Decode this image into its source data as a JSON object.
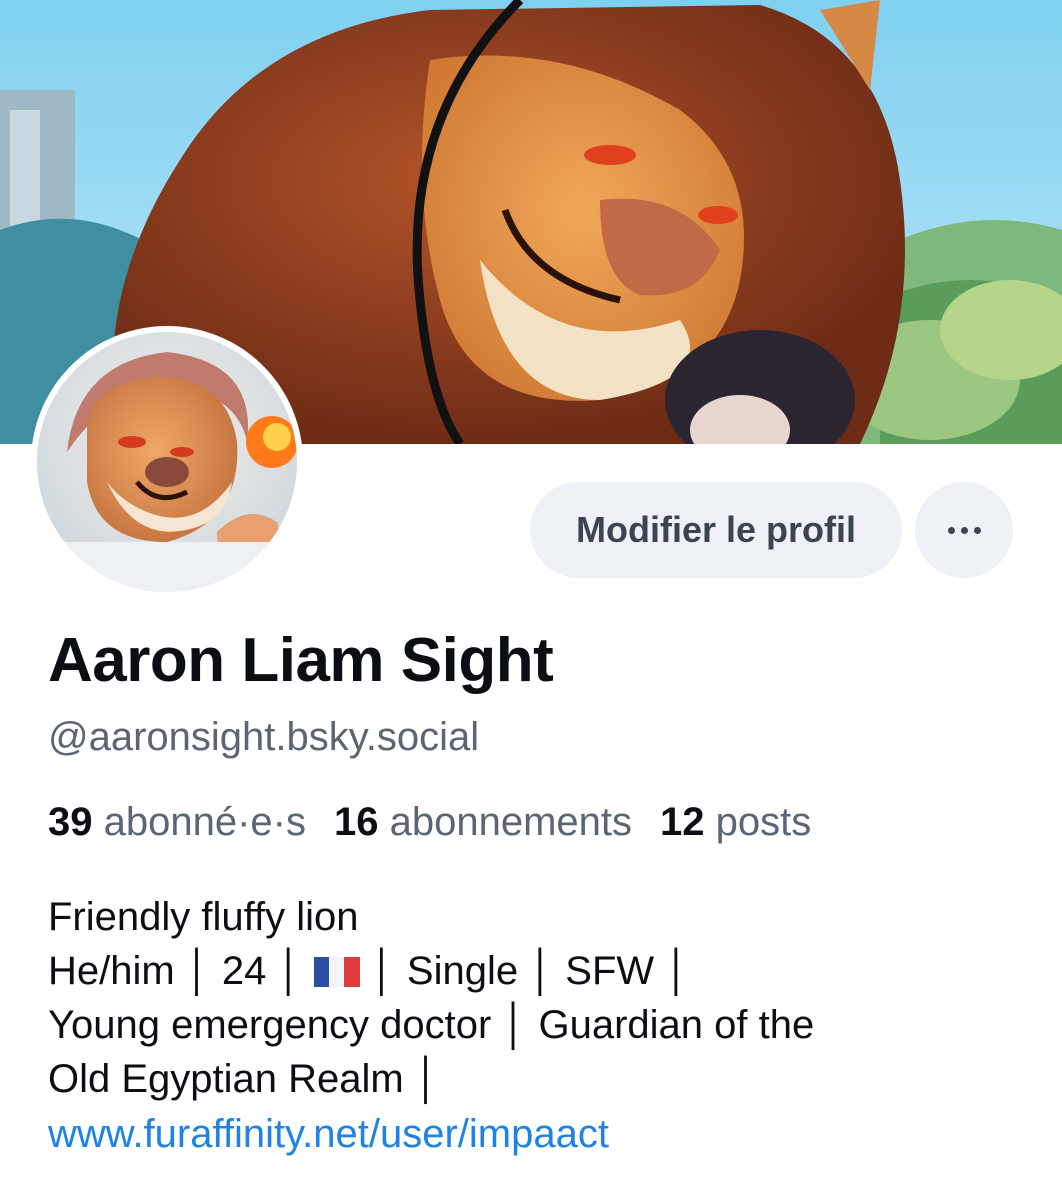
{
  "profile": {
    "display_name": "Aaron Liam Sight",
    "handle": "@aaronsight.bsky.social",
    "stats": {
      "followers_count": "39",
      "followers_label": "abonné·e·s",
      "following_count": "16",
      "following_label": "abonnements",
      "posts_count": "12",
      "posts_label": "posts"
    },
    "bio_lines": {
      "line1": "Friendly fluffy lion",
      "line2_a": "He/him │ 24 │ ",
      "line2_b": " │ Single │ SFW │",
      "line3": "Young emergency doctor │ Guardian of the",
      "line4": "Old Egyptian Realm │"
    },
    "link": "www.furaffinity.net/user/impaact"
  },
  "actions": {
    "edit_label": "Modifier le profil",
    "more_icon": "ellipsis-icon"
  },
  "colors": {
    "accent_link": "#1f82e6",
    "button_bg": "#eef1f5",
    "muted_text": "#5a6675"
  }
}
